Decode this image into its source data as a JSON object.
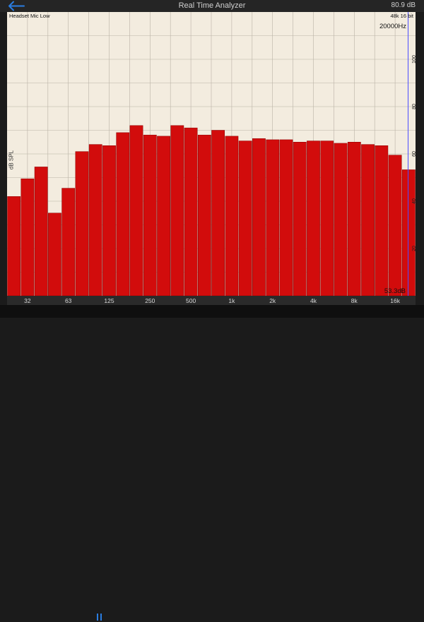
{
  "app": {
    "title": "Real Time Analyzer",
    "level_readout": "80.9 dB",
    "input_source": "Headset Mic Low",
    "sample_format": "48k 16 bit",
    "frequency_readout": "20000Hz",
    "spl_readout": "53.3dB"
  },
  "colors": {
    "bar": "#d20c0c",
    "bar_stroke": "#8a0000",
    "cursor": "#4d4dff",
    "background": "#f3ecdf",
    "grid": "#b9b2a6"
  },
  "icons": {
    "back": "back-arrow-icon",
    "pause": "pause-icon"
  },
  "chart_data": {
    "type": "bar",
    "ylabel": "dB SPL",
    "ylim": [
      0,
      120
    ],
    "y_ticks": [
      20,
      40,
      60,
      80,
      100
    ],
    "x_tick_labels": [
      "32",
      "63",
      "125",
      "250",
      "500",
      "1k",
      "2k",
      "4k",
      "8k",
      "16k"
    ],
    "values": [
      42,
      49.5,
      54.5,
      35,
      45.5,
      61,
      64,
      63.5,
      69,
      72,
      68,
      67.5,
      72,
      71,
      68,
      70,
      67.5,
      65.5,
      66.5,
      66,
      66,
      65,
      65.5,
      65.5,
      64.5,
      65,
      64,
      63.5,
      59.5,
      53.3
    ],
    "grid": true
  }
}
